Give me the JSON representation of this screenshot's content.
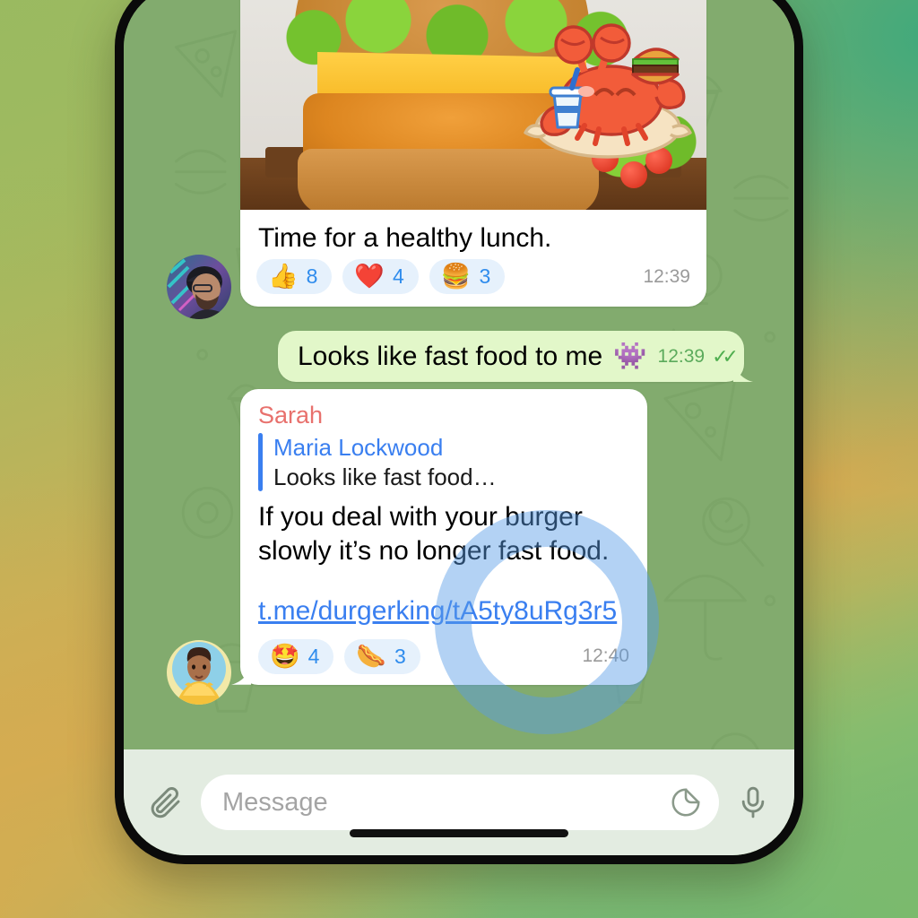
{
  "app": {
    "name": "Telegram Chat"
  },
  "wallpaper": {
    "color": "#82ab6e",
    "pattern": "food-doodles"
  },
  "messages": [
    {
      "type": "incoming-photo",
      "photo_alt": "burger-photo",
      "sticker": "crab-sticker",
      "caption": "Time for a healthy lunch.",
      "time": "12:39",
      "avatar": "avatar-man-beanie",
      "reactions": [
        {
          "emoji": "👍",
          "name": "thumbs-up",
          "count": "8"
        },
        {
          "emoji": "❤️",
          "name": "red-heart",
          "count": "4"
        },
        {
          "emoji": "🍔",
          "name": "hamburger",
          "count": "3"
        }
      ]
    },
    {
      "type": "outgoing",
      "text": "Looks like fast food to me",
      "emoji": "👾",
      "time": "12:39",
      "status": "read",
      "ticks": "✓✓"
    },
    {
      "type": "incoming-reply",
      "sender": "Sarah",
      "quote_name": "Maria Lockwood",
      "quote_text": "Looks like fast food…",
      "body": "If you deal with your burger slowly it’s no longer fast food.",
      "link": "t.me/durgerking/tA5ty8uRg3r5",
      "time": "12:40",
      "avatar": "avatar-woman-yellow",
      "reactions": [
        {
          "emoji": "🤩",
          "name": "star-struck",
          "count": "4"
        },
        {
          "emoji": "🌭",
          "name": "hot-dog",
          "count": "3"
        }
      ]
    }
  ],
  "composer": {
    "placeholder": "Message",
    "attach_icon": "paperclip-icon",
    "sticker_icon": "sticker-icon",
    "voice_icon": "microphone-icon"
  },
  "overlay": {
    "tap_ring": "tap-gesture-ring",
    "color": "#5a9ee8"
  },
  "colors": {
    "bubble_in": "#ffffff",
    "bubble_out": "#e2f7c9",
    "reaction_pill": "#e6f1fc",
    "reaction_count": "#2f8ced",
    "sender_name": "#e8716d",
    "quote_accent": "#3a7ff0",
    "link": "#3a7ff0",
    "time_in": "#9a9a9a",
    "time_out": "#5cab5c"
  }
}
